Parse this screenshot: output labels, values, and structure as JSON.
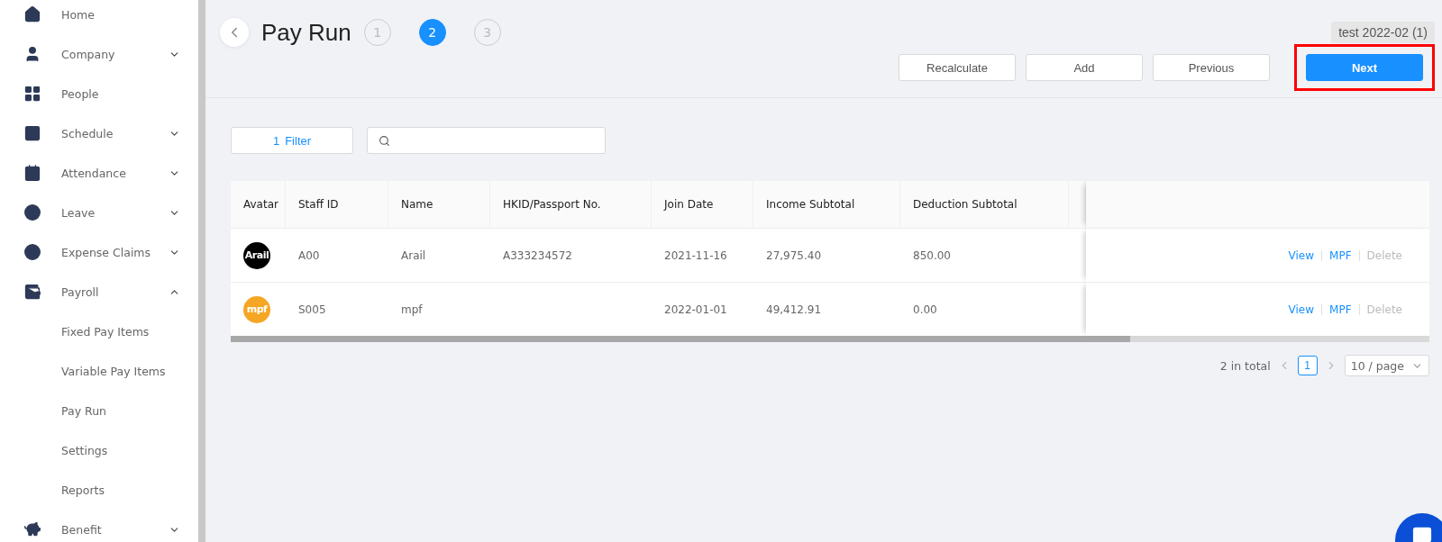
{
  "sidebar": {
    "items": [
      {
        "label": "Home"
      },
      {
        "label": "Company",
        "expanded": false
      },
      {
        "label": "People"
      },
      {
        "label": "Schedule",
        "expanded": false
      },
      {
        "label": "Attendance",
        "expanded": false
      },
      {
        "label": "Leave",
        "expanded": false
      },
      {
        "label": "Expense Claims",
        "expanded": false
      },
      {
        "label": "Payroll",
        "expanded": true,
        "children": [
          {
            "label": "Fixed Pay Items"
          },
          {
            "label": "Variable Pay Items"
          },
          {
            "label": "Pay Run"
          },
          {
            "label": "Settings"
          },
          {
            "label": "Reports"
          }
        ]
      },
      {
        "label": "Benefit",
        "expanded": false
      }
    ]
  },
  "header": {
    "title": "Pay Run",
    "steps": [
      {
        "label": "1",
        "selected": false
      },
      {
        "label": "2",
        "selected": true
      },
      {
        "label": "3",
        "selected": false
      }
    ],
    "tag": "test 2022-02 (1)",
    "buttons": [
      {
        "label": "Recalculate",
        "kind": "default",
        "highlighted": false
      },
      {
        "label": "Add",
        "kind": "default",
        "highlighted": false
      },
      {
        "label": "Previous",
        "kind": "default",
        "highlighted": false
      },
      {
        "label": "Next",
        "kind": "primary",
        "highlighted": true
      }
    ]
  },
  "toolbar": {
    "filter": {
      "count": "1",
      "label": "Filter"
    }
  },
  "table": {
    "columns": [
      "Avatar",
      "Staff ID",
      "Name",
      "HKID/Passport No.",
      "Join Date",
      "Income Subtotal",
      "Deduction Subtotal"
    ],
    "rows": [
      {
        "color": "#000000",
        "cells": [
          "Arail",
          "A00",
          "Arail",
          "A333234572",
          "2021-11-16",
          "27,975.40",
          "850.00"
        ],
        "actions": [
          {
            "label": "View",
            "disabled": false
          },
          {
            "label": "MPF",
            "disabled": false
          },
          {
            "label": "Delete",
            "disabled": true
          }
        ]
      },
      {
        "color": "#f5a623",
        "cells": [
          "mpf",
          "S005",
          "mpf",
          "",
          "2022-01-01",
          "49,412.91",
          "0.00"
        ],
        "actions": [
          {
            "label": "View",
            "disabled": false
          },
          {
            "label": "MPF",
            "disabled": false
          },
          {
            "label": "Delete",
            "disabled": true
          }
        ]
      }
    ]
  },
  "pagination": {
    "total": "2 in total",
    "pages": [
      {
        "label": "1",
        "selected": true
      }
    ],
    "page_size": "10 / page"
  }
}
